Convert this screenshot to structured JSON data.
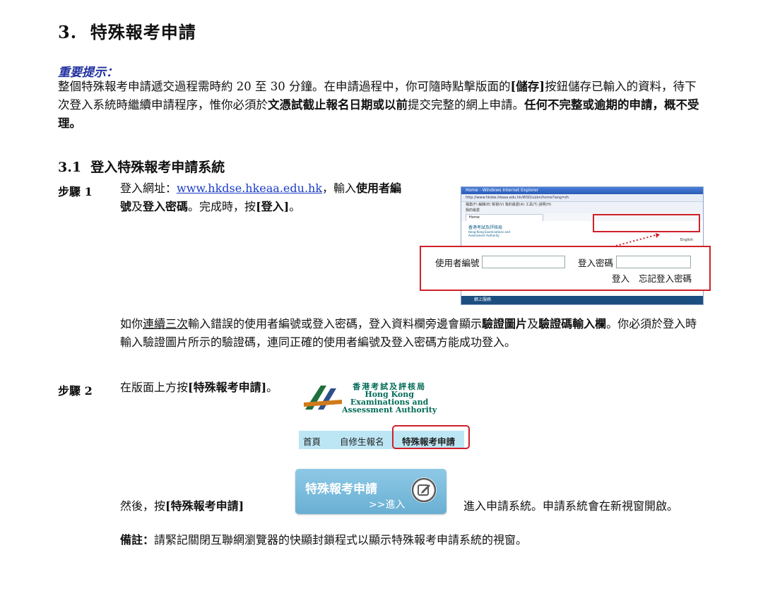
{
  "section": {
    "number": "3.",
    "title": "特殊報考申請"
  },
  "notice": {
    "heading": "重要提示：",
    "text_1": "整個特殊報考申請遞交過程需時約 20 至 30 分鐘。在申請過程中，你可隨時點擊版面的",
    "bold_1": "[儲存]",
    "text_2": "按鈕儲存已輸入的資料，待下次登入系統時繼續申請程序，惟你必須於",
    "bold_2": "文憑試截止報名日期或以前",
    "text_3": "提交完整的網上申請。",
    "bold_3": "任何不完整或逾期的申請，概不受理。"
  },
  "subsection": {
    "number": "3.1",
    "title": "登入特殊報考申請系統"
  },
  "step1": {
    "label": "步驟 1",
    "pre": "登入網址：",
    "url": "www.hkdse.hkeaa.edu.hk",
    "mid1": "，輸入",
    "b1": "使用者編號",
    "mid2": "及",
    "b2": "登入密碼",
    "mid3": "。完成時，按",
    "b3": "[登入]",
    "end": "。",
    "para2_a": "如你",
    "para2_u": "連續三次",
    "para2_b": "輸入錯誤的使用者編號或登入密碼，登入資料欄旁邊會顯示",
    "para2_b1": "驗證圖片",
    "para2_c": "及",
    "para2_b2": "驗證碼輸入欄",
    "para2_d": "。你必須於登入時輸入驗證圖片所示的驗證碼，連同正確的使用者編號及登入密碼方能成功登入。"
  },
  "browser": {
    "title": "Home - Windows Internet Explorer",
    "address": "http://www.hkdse.hkeaa.edu.hk/WSD/ul/en/home?lang=zh",
    "menu": "檔案(F)  編輯(E)  檢視(V)  我的最愛(A)  工具(T)  說明(H)",
    "favorites": "我的最愛",
    "tab": "Home",
    "logo_cn": "香港考試及評核局",
    "logo_en": "Hong Kong Examinations and Assessment Authority",
    "english": "English",
    "services": "網上服務"
  },
  "login": {
    "user_label": "使用者編號",
    "pwd_label": "登入密碼",
    "login_link": "登入",
    "forgot_link": "忘記登入密碼"
  },
  "step2": {
    "label": "步驟 2",
    "pre": "在版面上方按",
    "b": "[特殊報考申請]",
    "end": "。",
    "then_pre": "然後，按",
    "then_b": "[特殊報考申請]",
    "after": "進入申請系統。申請系統會在新視窗開啟。"
  },
  "logo": {
    "cn": "香港考試及評核局",
    "en1": "Hong Kong",
    "en2": "Examinations and",
    "en3": "Assessment Authority"
  },
  "nav": {
    "home": "首頁",
    "self": "自修生報名",
    "special": "特殊報考申請"
  },
  "apply_button": {
    "title": "特殊報考申請",
    "enter": ">>進入"
  },
  "remark": {
    "label": "備註：",
    "text": "請緊記關閉互聯網瀏覽器的快顯封鎖程式以顯示特殊報考申請系統的視窗。"
  }
}
